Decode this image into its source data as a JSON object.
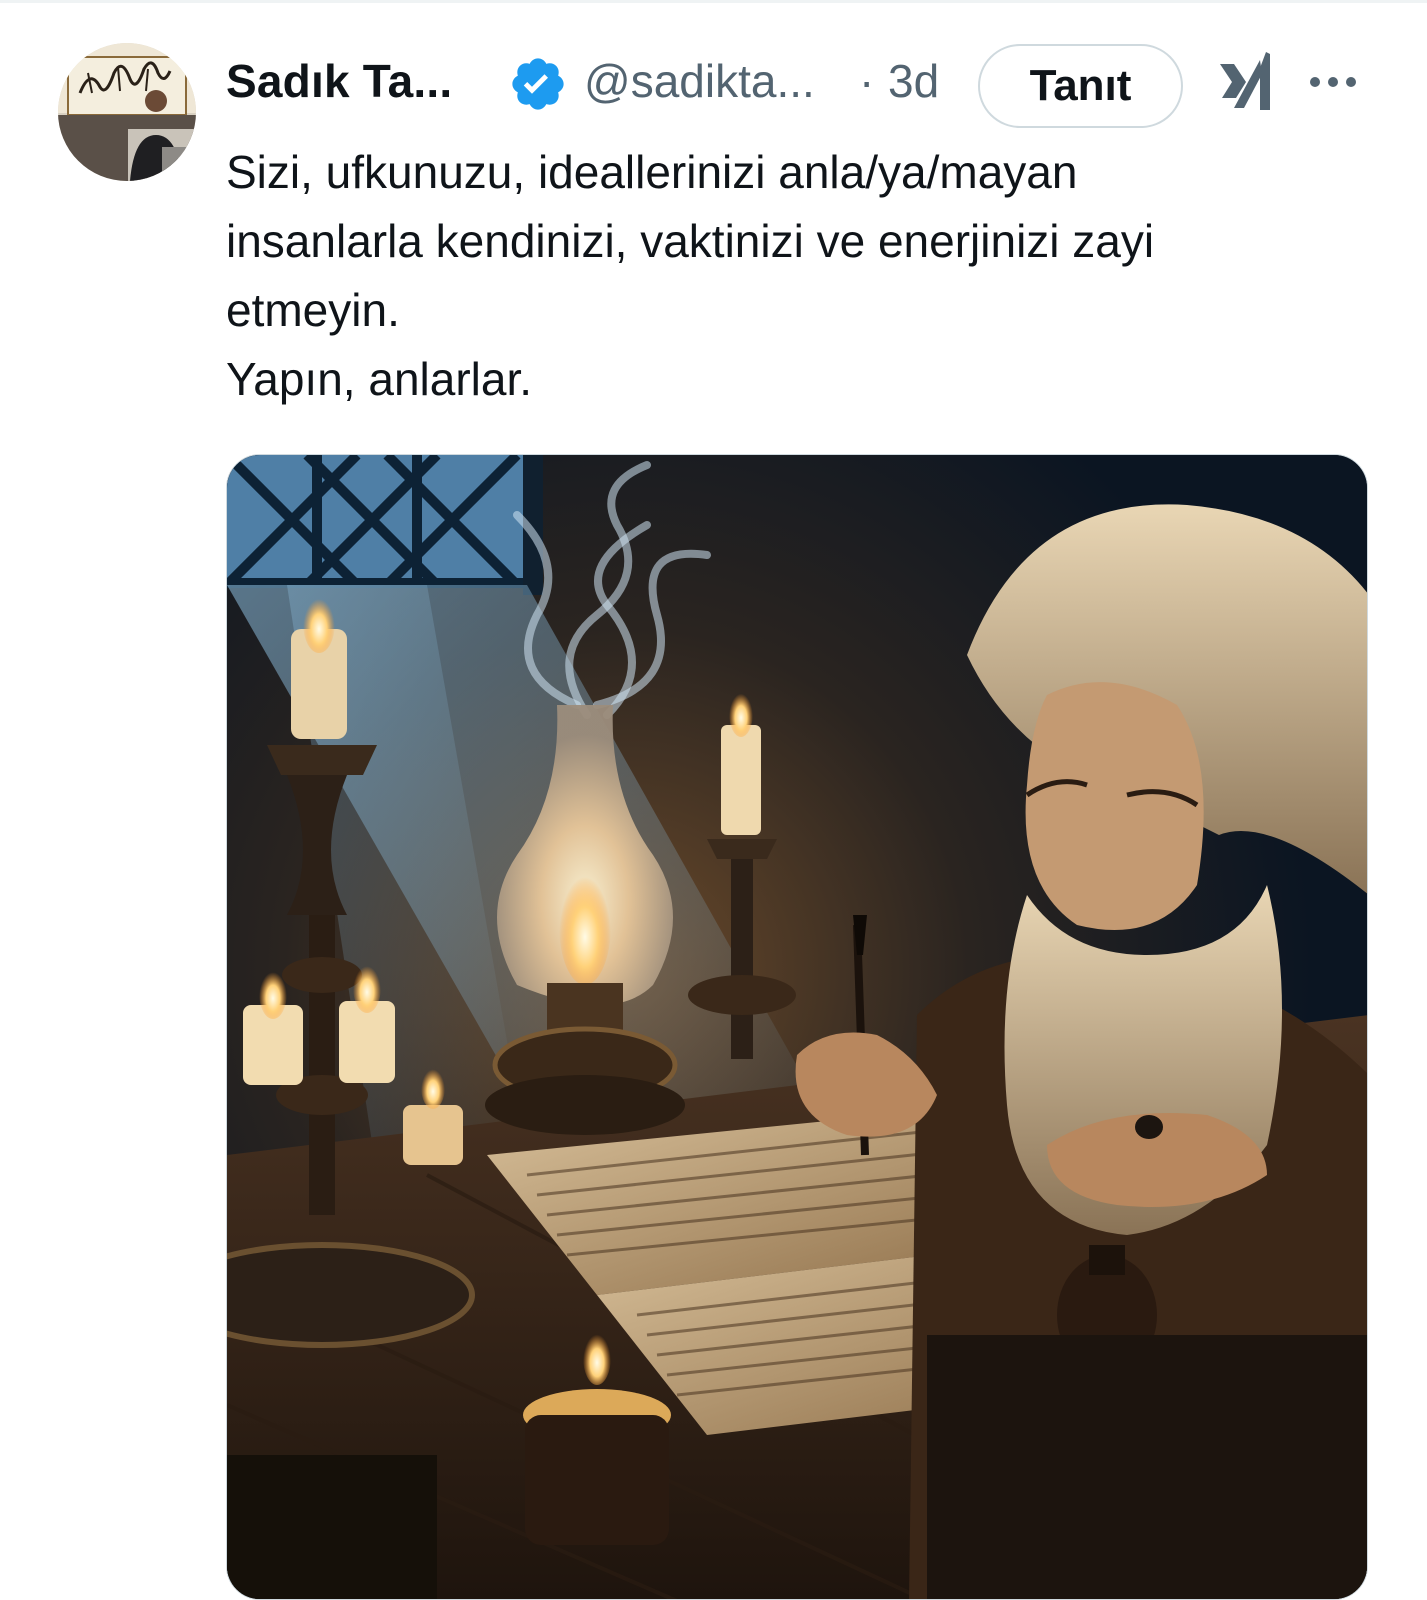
{
  "tweet": {
    "author_name": "Sadık Ta...",
    "handle": "@sadikta...",
    "separator": "·",
    "time": "3d",
    "button_label": "Tanıt",
    "text_lines": [
      "Sizi, ufkunuzu, ideallerinizi anla/ya/mayan",
      "insanlarla kendinizi, vaktinizi ve enerjinizi zayi",
      "etmeyin.",
      "Yapın, anlarlar."
    ]
  },
  "colors": {
    "text": "#0f1419",
    "secondary": "#536471",
    "verified": "#1d9bf0",
    "border": "#cfd9de"
  },
  "icons": {
    "verified": "verified-badge-icon",
    "grok": "grok-icon",
    "more": "more-options-icon"
  }
}
